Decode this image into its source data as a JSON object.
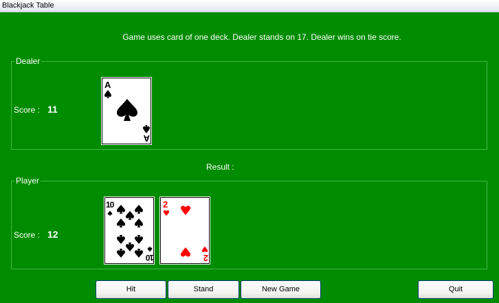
{
  "window": {
    "title": "Blackjack Table"
  },
  "info_text": "Game uses card of one deck. Dealer stands on 17. Dealer wins on tie score.",
  "dealer": {
    "group_label": "Dealer",
    "score_label": "Score :",
    "score_value": "11",
    "cards": [
      {
        "rank": "A",
        "suit": "spades"
      }
    ]
  },
  "result": {
    "label": "Result :"
  },
  "player": {
    "group_label": "Player",
    "score_label": "Score :",
    "score_value": "12",
    "cards": [
      {
        "rank": "10",
        "suit": "spades"
      },
      {
        "rank": "2",
        "suit": "hearts"
      }
    ]
  },
  "buttons": {
    "hit": "Hit",
    "stand": "Stand",
    "new_game": "New Game",
    "quit": "Quit"
  },
  "colors": {
    "table": "#008c00",
    "black_suit": "#000000",
    "red_suit": "#ff0000"
  }
}
